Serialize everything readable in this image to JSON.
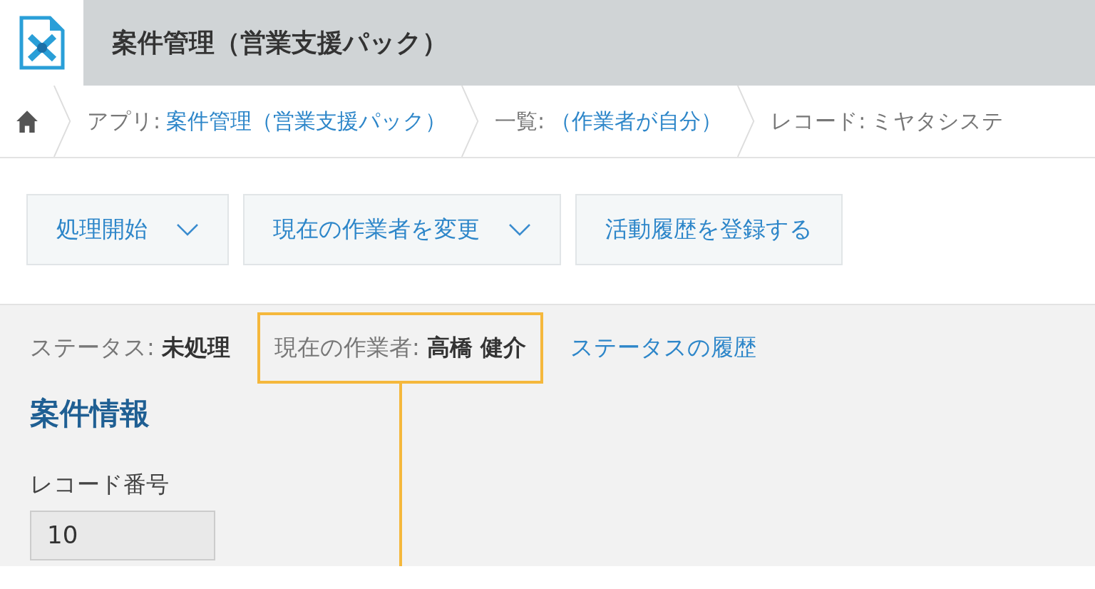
{
  "app": {
    "title": "案件管理（営業支援パック）"
  },
  "breadcrumbs": [
    {
      "label": "アプリ:",
      "value": "案件管理（営業支援パック）",
      "kind": "link"
    },
    {
      "label": "一覧:",
      "value": "（作業者が自分）",
      "kind": "link"
    },
    {
      "label": "レコード:",
      "value": "ミヤタシステ",
      "kind": "text"
    }
  ],
  "actions": [
    {
      "label": "処理開始",
      "dropdown": true
    },
    {
      "label": "現在の作業者を変更",
      "dropdown": true
    },
    {
      "label": "活動履歴を登録する",
      "dropdown": false
    }
  ],
  "status": {
    "label": "ステータス:",
    "value": "未処理"
  },
  "assignee": {
    "label": "現在の作業者:",
    "value": "高橋 健介",
    "highlighted": true
  },
  "history_link": "ステータスの履歴",
  "section_title": "案件情報",
  "fields": [
    {
      "label": "レコード番号",
      "value": "10"
    }
  ]
}
